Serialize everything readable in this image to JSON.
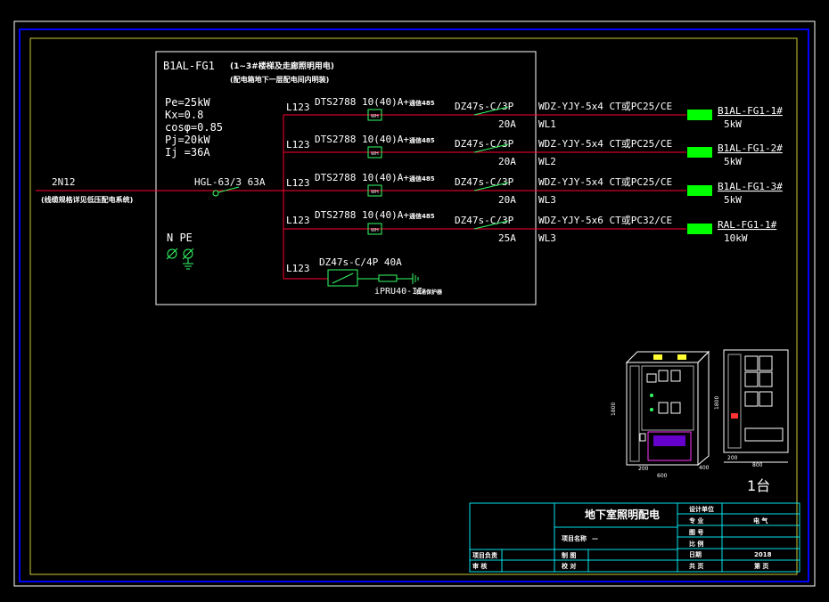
{
  "panel": {
    "name": "B1AL-FG1",
    "note1": "(1~3#楼梯及走廊照明用电)",
    "note2": "(配电箱地下一层配电间内明装)",
    "params": [
      "Pe=25kW",
      "Kx=0.8",
      "cosφ=0.85",
      "Pj=20kW",
      "Ij =36A"
    ],
    "ne_label": "N PE"
  },
  "incoming": {
    "cable": "2N12",
    "note": "(线缆规格详见低压配电系统)",
    "main_switch": "HGL-63/3 63A"
  },
  "circuits": [
    {
      "phase": "L123",
      "meter": "DTS2788 10(40)A+",
      "meter_suffix": "通信485",
      "breaker": "DZ47s-C/3P",
      "rating": "20A",
      "cable": "WDZ-YJY-5x4 CT或PC25/CE",
      "wl": "WL1",
      "dest": "B1AL-FG1-1#",
      "power": "5kW"
    },
    {
      "phase": "L123",
      "meter": "DTS2788 10(40)A+",
      "meter_suffix": "通信485",
      "breaker": "DZ47s-C/3P",
      "rating": "20A",
      "cable": "WDZ-YJY-5x4 CT或PC25/CE",
      "wl": "WL2",
      "dest": "B1AL-FG1-2#",
      "power": "5kW"
    },
    {
      "phase": "L123",
      "meter": "DTS2788 10(40)A+",
      "meter_suffix": "通信485",
      "breaker": "DZ47s-C/3P",
      "rating": "20A",
      "cable": "WDZ-YJY-5x4 CT或PC25/CE",
      "wl": "WL3",
      "dest": "B1AL-FG1-3#",
      "power": "5kW"
    },
    {
      "phase": "L123",
      "meter": "DTS2788 10(40)A+",
      "meter_suffix": "通信485",
      "breaker": "DZ47s-C/3P",
      "rating": "25A",
      "cable": "WDZ-YJY-5x6 CT或PC32/CE",
      "wl": "WL3",
      "dest": "RAL-FG1-1#",
      "power": "10kW"
    }
  ],
  "spd": {
    "phase": "L123",
    "breaker": "DZ47s-C/4P 40A",
    "device": "iPRU40-II",
    "device_suffix": "浪涌保护器"
  },
  "meter_box_label": "WH",
  "cabinet": {
    "dims": [
      "800",
      "1800",
      "400",
      "200",
      "200",
      "600",
      "200",
      "800",
      "1800"
    ],
    "quantity": "1台"
  },
  "title_block": {
    "drawing_title": "地下室照明配电",
    "design_unit": "设计单位",
    "major_label": "专 业",
    "major_value": "电 气",
    "drawing_no_label": "图 号",
    "scale_label": "比 例",
    "project_name_label": "项目名称",
    "project_name_value": "—",
    "date_label": "日期",
    "date_value": "2018",
    "project_lead": "项目负责",
    "checked": "审 核",
    "drawn": "制 图",
    "verified": "校 对",
    "sheets_total": "共 页",
    "sheet_no": "第 页"
  },
  "colors": {
    "background": "#000000",
    "wire": "#ff0033",
    "outer_border": "#0000ff",
    "frame": "#ffff33",
    "component": "#33ff66",
    "dest_block": "#00ff00",
    "text": "#ffffff",
    "title_block": "#00e5ee"
  }
}
